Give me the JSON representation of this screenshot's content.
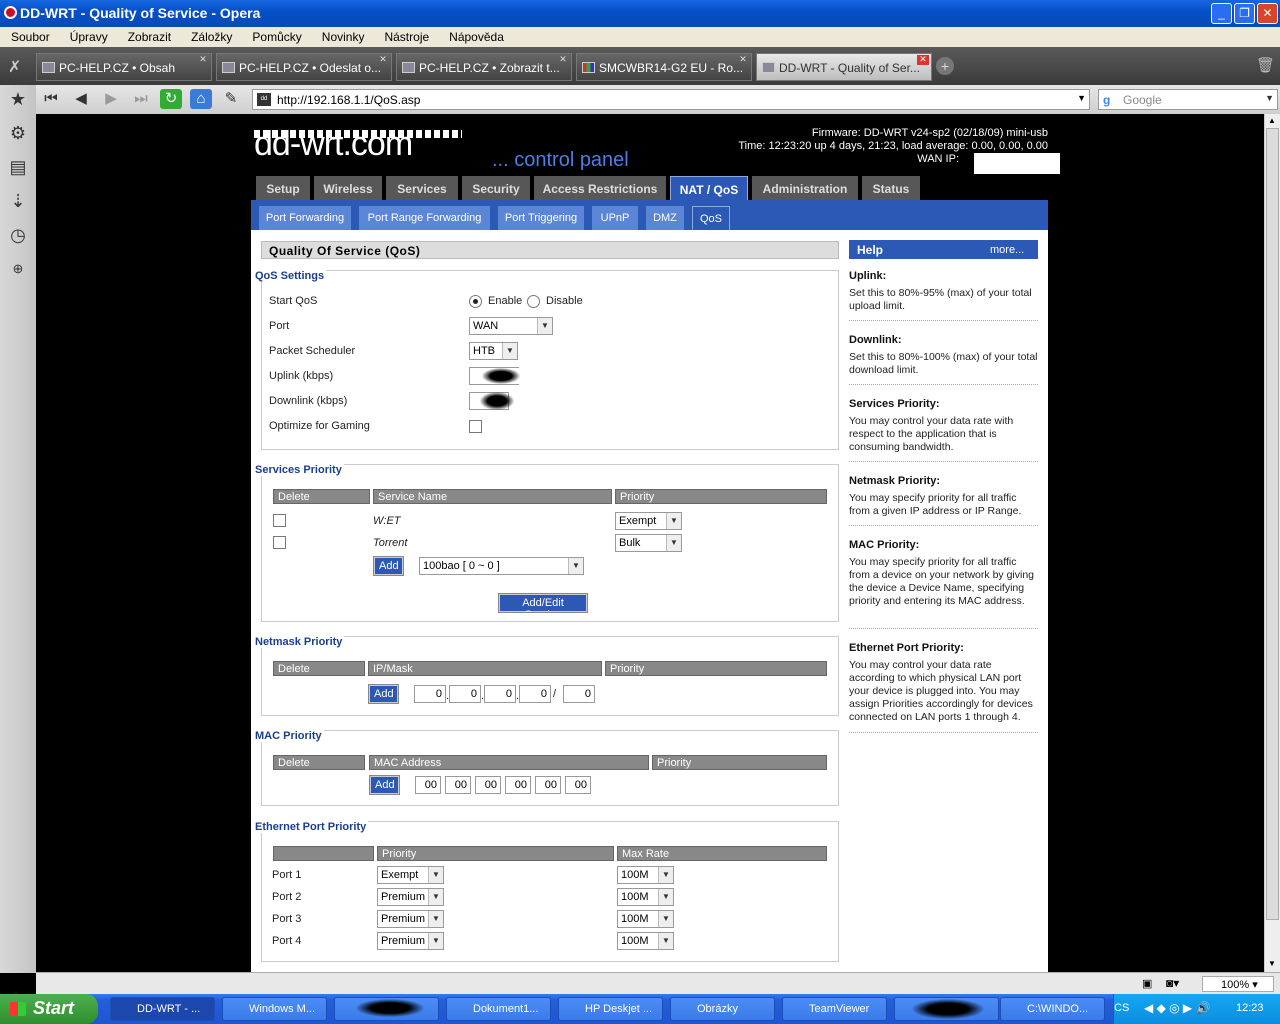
{
  "window": {
    "title": "DD-WRT - Quality of Service - Opera"
  },
  "menu": [
    "Soubor",
    "Úpravy",
    "Zobrazit",
    "Záložky",
    "Pomůcky",
    "Novinky",
    "Nástroje",
    "Nápověda"
  ],
  "tabs": [
    "PC-HELP.CZ • Obsah",
    "PC-HELP.CZ • Odeslat o...",
    "PC-HELP.CZ • Zobrazit t...",
    "SMCWBR14-G2 EU - Ro...",
    "DD-WRT - Quality of Ser..."
  ],
  "address": "http://192.168.1.1/QoS.asp",
  "search_placeholder": "Google",
  "header": {
    "cpanel": "... control panel",
    "firmware": "Firmware: DD-WRT v24-sp2 (02/18/09) mini-usb",
    "time": "Time: 12:23:20 up 4 days, 21:23, load average: 0.00, 0.00, 0.00",
    "wanip": "WAN IP:",
    "logo": "dd-wrt.com"
  },
  "mainnav": [
    "Setup",
    "Wireless",
    "Services",
    "Security",
    "Access Restrictions",
    "NAT / QoS",
    "Administration",
    "Status"
  ],
  "subnav": [
    "Port Forwarding",
    "Port Range Forwarding",
    "Port Triggering",
    "UPnP",
    "DMZ",
    "QoS"
  ],
  "page_title": "Quality Of Service (QoS)",
  "qos": {
    "legend": "QoS Settings",
    "start": "Start QoS",
    "enable": "Enable",
    "disable": "Disable",
    "port": "Port",
    "port_val": "WAN",
    "sched": "Packet Scheduler",
    "sched_val": "HTB",
    "uplink": "Uplink (kbps)",
    "downlink": "Downlink (kbps)",
    "gaming": "Optimize for Gaming"
  },
  "services": {
    "legend": "Services Priority",
    "cols": [
      "Delete",
      "Service Name",
      "Priority"
    ],
    "rows": [
      {
        "name": "W:ET",
        "priority": "Exempt"
      },
      {
        "name": "Torrent",
        "priority": "Bulk"
      }
    ],
    "add": "Add",
    "select": "100bao [ 0 ~ 0 ]",
    "edit": "Add/Edit Service"
  },
  "netmask": {
    "legend": "Netmask Priority",
    "cols": [
      "Delete",
      "IP/Mask",
      "Priority"
    ],
    "add": "Add",
    "ip": [
      "0",
      "0",
      "0",
      "0"
    ],
    "mask": "0",
    "slash": "/"
  },
  "mac": {
    "legend": "MAC Priority",
    "cols": [
      "Delete",
      "MAC Address",
      "Priority"
    ],
    "add": "Add",
    "octets": [
      "00",
      "00",
      "00",
      "00",
      "00",
      "00"
    ]
  },
  "eth": {
    "legend": "Ethernet Port Priority",
    "cols": [
      "",
      "Priority",
      "Max Rate"
    ],
    "rows": [
      {
        "port": "Port 1",
        "prio": "Exempt",
        "rate": "100M"
      },
      {
        "port": "Port 2",
        "prio": "Premium",
        "rate": "100M"
      },
      {
        "port": "Port 3",
        "prio": "Premium",
        "rate": "100M"
      },
      {
        "port": "Port 4",
        "prio": "Premium",
        "rate": "100M"
      }
    ]
  },
  "help": {
    "title": "Help",
    "more": "more...",
    "items": [
      {
        "h": "Uplink:",
        "p": "Set this to 80%-95% (max) of your total upload limit."
      },
      {
        "h": "Downlink:",
        "p": "Set this to 80%-100% (max) of your total download limit."
      },
      {
        "h": "Services Priority:",
        "p": "You may control your data rate with respect to the application that is consuming bandwidth."
      },
      {
        "h": "Netmask Priority:",
        "p": "You may specify priority for all traffic from a given IP address or IP Range."
      },
      {
        "h": "MAC Priority:",
        "p": "You may specify priority for all traffic from a device on your network by giving the device a Device Name, specifying priority and entering its MAC address."
      },
      {
        "h": "Ethernet Port Priority:",
        "p": "You may control your data rate according to which physical LAN port your device is plugged into. You may assign Priorities accordingly for devices connected on LAN ports 1 through 4."
      }
    ]
  },
  "statusbar": {
    "zoom": "100%"
  },
  "taskbar": {
    "start": "Start",
    "tasks": [
      "DD-WRT - ...",
      "Windows M...",
      "",
      "Dokument1...",
      "HP Deskjet ...",
      "Obrázky",
      "TeamViewer",
      "",
      "C:\\WINDO..."
    ],
    "lang": "CS",
    "clock": "12:23"
  }
}
